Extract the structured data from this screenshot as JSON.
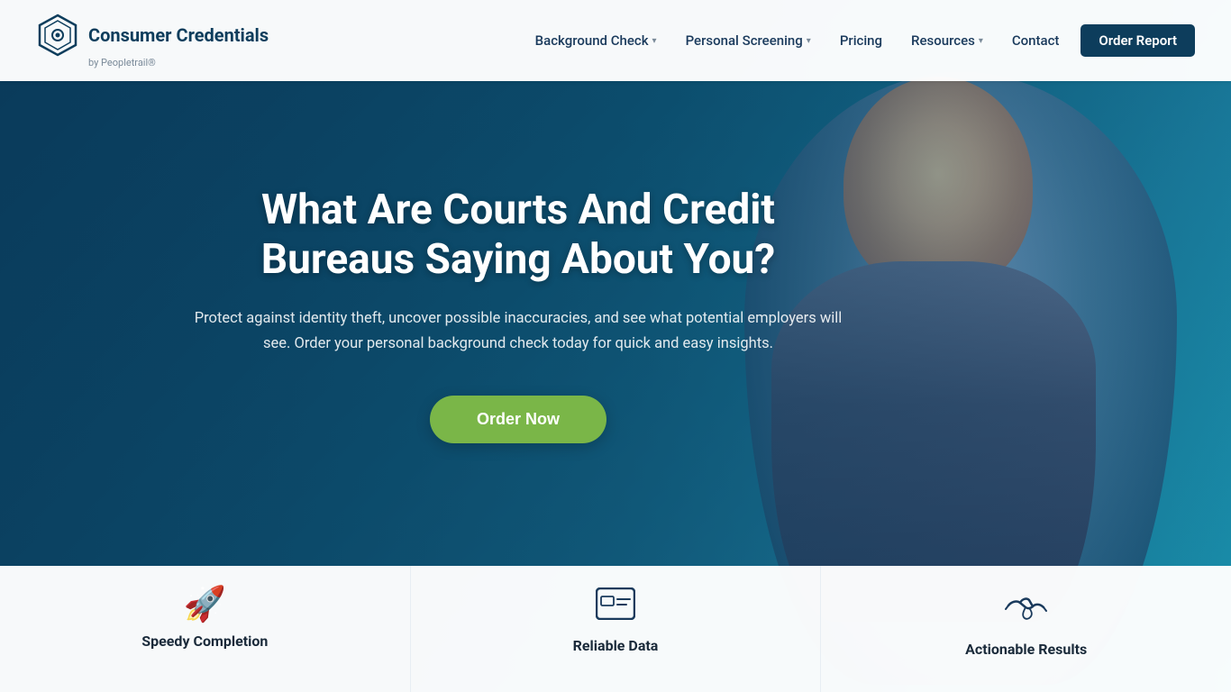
{
  "header": {
    "logo_text": "Consumer Credentials",
    "logo_sub": "by Peopletrail®",
    "nav": [
      {
        "label": "Background Check",
        "has_dropdown": true
      },
      {
        "label": "Personal Screening",
        "has_dropdown": true
      },
      {
        "label": "Pricing",
        "has_dropdown": false
      },
      {
        "label": "Resources",
        "has_dropdown": true
      },
      {
        "label": "Contact",
        "has_dropdown": false
      }
    ],
    "order_label": "Order Report"
  },
  "hero": {
    "title": "What Are Courts And Credit Bureaus Saying About You?",
    "subtitle": "Protect against identity theft, uncover possible inaccuracies, and see what potential employers will see. Order your personal background check today for quick and easy insights.",
    "cta_label": "Order Now"
  },
  "features": [
    {
      "icon": "🚀",
      "label": "Speedy Completion"
    },
    {
      "icon": "🪪",
      "label": "Reliable Data"
    },
    {
      "icon": "🤝",
      "label": "Actionable Results"
    }
  ],
  "colors": {
    "nav_bg": "#ffffff",
    "hero_bg": "#0d5075",
    "cta_bg": "#7ab648",
    "logo_dark": "#0d3d5c"
  }
}
